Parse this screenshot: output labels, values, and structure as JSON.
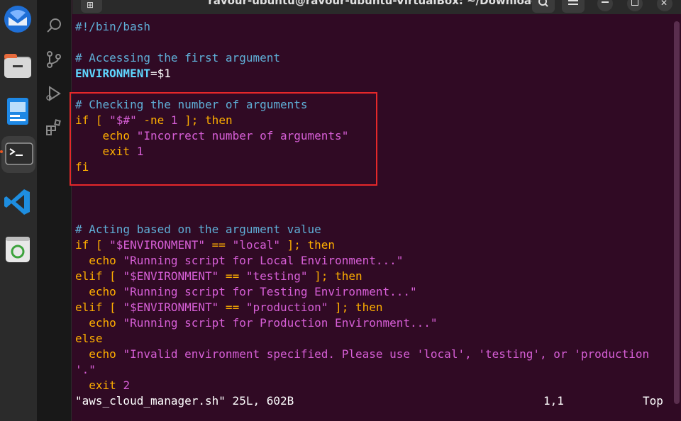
{
  "window": {
    "title": "ravour-ubuntu@ravour-ubuntu-VirtualBox: ~/Downloads",
    "new_tab_icon": "new-tab-icon",
    "search_icon": "search-icon",
    "menu_icon": "hamburger-menu-icon",
    "minimize_icon": "minimize-icon",
    "maximize_icon": "maximize-icon",
    "close_icon": "close-icon"
  },
  "dock": {
    "apps": [
      "thunderbird",
      "files",
      "libreoffice-impress",
      "terminal",
      "vscode",
      "trash"
    ]
  },
  "activity_bar": {
    "icons": [
      "search-icon",
      "source-control-icon",
      "run-debug-icon",
      "extensions-icon"
    ]
  },
  "editor": {
    "lines": {
      "l1": "#!/bin/bash",
      "l3": "# Accessing the first argument",
      "l4_var": "ENVIRONMENT",
      "l4_rest": "=$1",
      "l6": "# Checking the number of arguments",
      "l7_if": "if",
      "l7_a": " [ ",
      "l7_str": "\"$#\"",
      "l7_b": " -ne ",
      "l7_num": "1",
      "l7_c": " ]; ",
      "l7_then": "then",
      "l8_echo": "    echo ",
      "l8_str": "\"Incorrect number of arguments\"",
      "l9_exit": "    exit ",
      "l9_num": "1",
      "l10": "fi",
      "l14": "# Acting based on the argument value",
      "l15_if": "if",
      "l15_a": " [ ",
      "l15_str1": "\"$ENVIRONMENT\"",
      "l15_b": " == ",
      "l15_str2": "\"local\"",
      "l15_c": " ]; ",
      "l15_then": "then",
      "l16_echo": "  echo ",
      "l16_str": "\"Running script for Local Environment...\"",
      "l17_elif": "elif",
      "l17_a": " [ ",
      "l17_str1": "\"$ENVIRONMENT\"",
      "l17_b": " == ",
      "l17_str2": "\"testing\"",
      "l17_c": " ]; ",
      "l17_then": "then",
      "l18_echo": "  echo ",
      "l18_str": "\"Running script for Testing Environment...\"",
      "l19_elif": "elif",
      "l19_a": " [ ",
      "l19_str1": "\"$ENVIRONMENT\"",
      "l19_b": " == ",
      "l19_str2": "\"production\"",
      "l19_c": " ]; ",
      "l19_then": "then",
      "l20_echo": "  echo ",
      "l20_str": "\"Running script for Production Environment...\"",
      "l21": "else",
      "l22_echo": "  echo ",
      "l22_str": "\"Invalid environment specified. Please use 'local', 'testing', or 'production",
      "l23_str": "'.\"",
      "l24_exit": "  exit ",
      "l24_num": "2"
    }
  },
  "status": {
    "file": "\"aws_cloud_manager.sh\" 25L, 602B",
    "position": "1,1",
    "scroll": "Top"
  },
  "colors": {
    "terminal_bg": "#300a24",
    "comment": "#5fafd7",
    "keyword": "#ffaf00",
    "string": "#d75fd7",
    "variable": "#5fd7ff",
    "highlight_box": "#e5282a"
  }
}
